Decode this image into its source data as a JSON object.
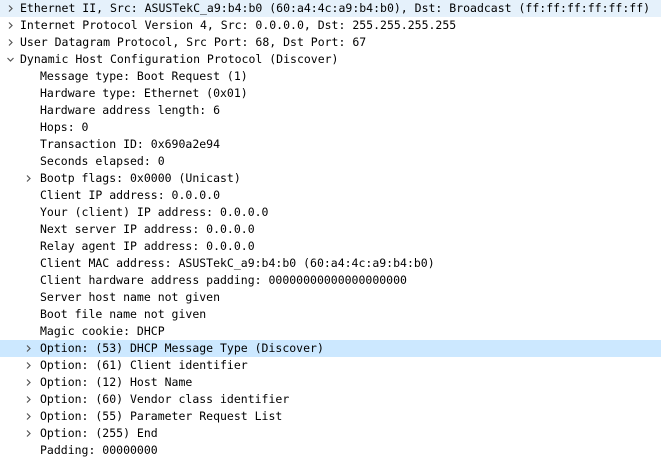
{
  "tree": [
    {
      "id": "ethernet",
      "label": "Ethernet II, Src: ASUSTekC_a9:b4:b0 (60:a4:4c:a9:b4:b0), Dst: Broadcast (ff:ff:ff:ff:ff:ff)",
      "level": 0,
      "expander": "collapsed",
      "selected": "first"
    },
    {
      "id": "ipv4",
      "label": "Internet Protocol Version 4, Src: 0.0.0.0, Dst: 255.255.255.255",
      "level": 0,
      "expander": "collapsed"
    },
    {
      "id": "udp",
      "label": "User Datagram Protocol, Src Port: 68, Dst Port: 67",
      "level": 0,
      "expander": "collapsed"
    },
    {
      "id": "dhcp",
      "label": "Dynamic Host Configuration Protocol (Discover)",
      "level": 0,
      "expander": "expanded"
    },
    {
      "id": "message-type",
      "label": "Message type: Boot Request (1)",
      "level": 1
    },
    {
      "id": "hardware-type",
      "label": "Hardware type: Ethernet (0x01)",
      "level": 1
    },
    {
      "id": "hardware-address-length",
      "label": "Hardware address length: 6",
      "level": 1
    },
    {
      "id": "hops",
      "label": "Hops: 0",
      "level": 1
    },
    {
      "id": "transaction-id",
      "label": "Transaction ID: 0x690a2e94",
      "level": 1
    },
    {
      "id": "seconds-elapsed",
      "label": "Seconds elapsed: 0",
      "level": 1
    },
    {
      "id": "bootp-flags",
      "label": "Bootp flags: 0x0000 (Unicast)",
      "level": 1,
      "expander": "collapsed"
    },
    {
      "id": "client-ip",
      "label": "Client IP address: 0.0.0.0",
      "level": 1
    },
    {
      "id": "your-ip",
      "label": "Your (client) IP address: 0.0.0.0",
      "level": 1
    },
    {
      "id": "next-server-ip",
      "label": "Next server IP address: 0.0.0.0",
      "level": 1
    },
    {
      "id": "relay-agent-ip",
      "label": "Relay agent IP address: 0.0.0.0",
      "level": 1
    },
    {
      "id": "client-mac",
      "label": "Client MAC address: ASUSTekC_a9:b4:b0 (60:a4:4c:a9:b4:b0)",
      "level": 1
    },
    {
      "id": "client-hw-padding",
      "label": "Client hardware address padding: 00000000000000000000",
      "level": 1
    },
    {
      "id": "server-host-name",
      "label": "Server host name not given",
      "level": 1
    },
    {
      "id": "boot-file-name",
      "label": "Boot file name not given",
      "level": 1
    },
    {
      "id": "magic-cookie",
      "label": "Magic cookie: DHCP",
      "level": 1
    },
    {
      "id": "option-53",
      "label": "Option: (53) DHCP Message Type (Discover)",
      "level": 1,
      "expander": "collapsed",
      "selected": "main"
    },
    {
      "id": "option-61",
      "label": "Option: (61) Client identifier",
      "level": 1,
      "expander": "collapsed"
    },
    {
      "id": "option-12",
      "label": "Option: (12) Host Name",
      "level": 1,
      "expander": "collapsed"
    },
    {
      "id": "option-60",
      "label": "Option: (60) Vendor class identifier",
      "level": 1,
      "expander": "collapsed"
    },
    {
      "id": "option-55",
      "label": "Option: (55) Parameter Request List",
      "level": 1,
      "expander": "collapsed"
    },
    {
      "id": "option-255",
      "label": "Option: (255) End",
      "level": 1,
      "expander": "collapsed"
    },
    {
      "id": "padding",
      "label": "Padding: 00000000",
      "level": 1
    }
  ],
  "colors": {
    "selected_background": "#cce8ff",
    "selected_first_background": "#e5f1fb",
    "text": "#000000",
    "expander": "#555555"
  }
}
